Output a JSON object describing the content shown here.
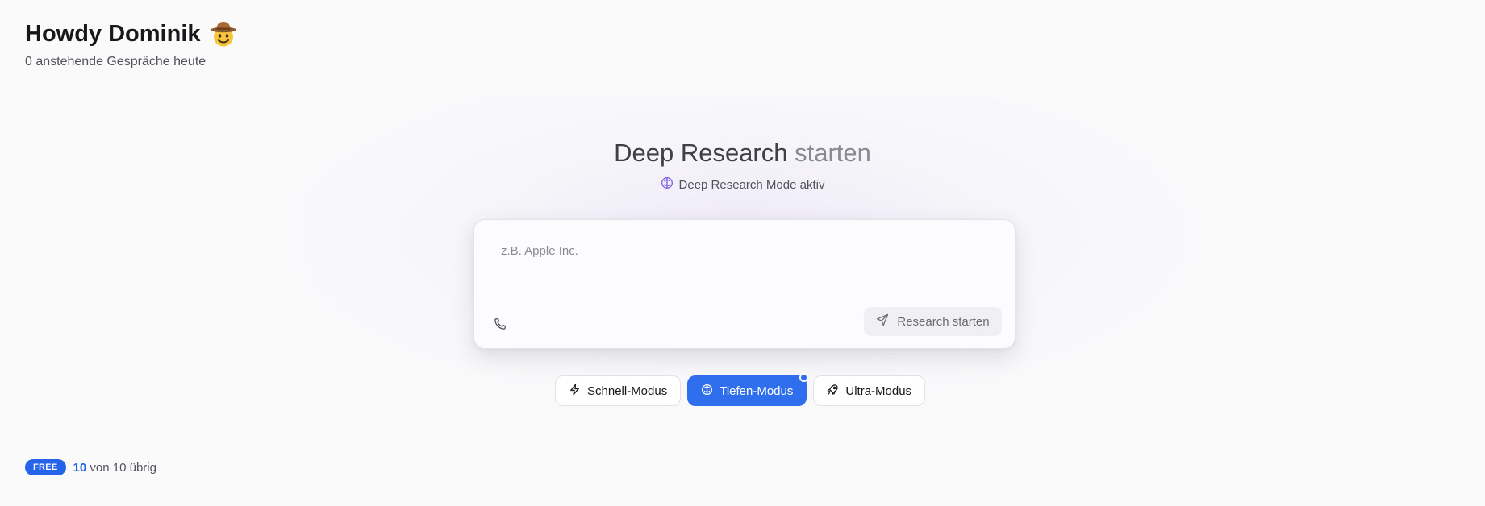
{
  "greeting": {
    "title": "Howdy Dominik",
    "emoji_icon": "cowboy-face-icon",
    "subtitle": "0 anstehende Gespräche heute"
  },
  "hero": {
    "title_main": "Deep Research",
    "title_muted": "starten",
    "mode_status": "Deep Research Mode aktiv",
    "mode_status_icon": "brain-icon"
  },
  "search": {
    "placeholder": "z.B. Apple Inc.",
    "value": "",
    "phone_icon": "phone-icon",
    "submit_label": "Research starten",
    "submit_icon": "send-icon"
  },
  "modes": [
    {
      "label": "Schnell-Modus",
      "icon": "lightning-icon",
      "active": false
    },
    {
      "label": "Tiefen-Modus",
      "icon": "brain-icon",
      "active": true
    },
    {
      "label": "Ultra-Modus",
      "icon": "rocket-icon",
      "active": false
    }
  ],
  "plan": {
    "badge": "FREE",
    "remaining": "10",
    "suffix": "von 10 übrig"
  },
  "colors": {
    "accent": "#2f6fed",
    "badge": "#2563eb",
    "background": "#fafafa"
  }
}
